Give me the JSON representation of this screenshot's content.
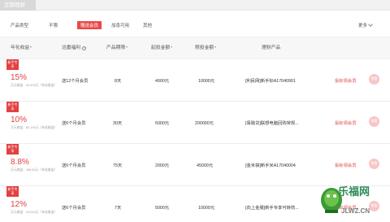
{
  "tabs": {
    "active_label": "定期理财"
  },
  "filter": {
    "label": "产品类型",
    "options": [
      {
        "label": "不限",
        "selected": false
      },
      {
        "label": "赠送会员",
        "selected": true
      },
      {
        "label": "加息可用",
        "selected": false
      },
      {
        "label": "其他",
        "selected": false
      }
    ],
    "more_label": "更多"
  },
  "table": {
    "headers": [
      "年化收益",
      "迅雷福利",
      "产品期限",
      "起投金额",
      "限投金额",
      "理财产品"
    ],
    "rows": [
      {
        "badge": "新手专享",
        "rate": "15%",
        "sub": "万元收益：32.876元（年化收益）",
        "welfare": "送12个月会员",
        "term": "8天",
        "min": "4000元",
        "max": "10000元",
        "product": "[利民网]新手标A17040901",
        "action": "投标领会员",
        "circle": "售罄"
      },
      {
        "badge": "新手专享",
        "rate": "10%",
        "sub": "万元收益：82.191元（年化收益）",
        "welfare": "送6个月会员",
        "term": "30天",
        "min": "5000元",
        "max": "200000元",
        "product": "[易融贷]联想电脑回购常规...",
        "action": "投标领会员",
        "circle": "售罄"
      },
      {
        "badge": "新手专享",
        "rate": "8.8%",
        "sub": "万元收益：168.82元（年化收益）",
        "welfare": "送6个月会员",
        "term": "75天",
        "min": "2000元",
        "max": "45000元",
        "product": "[金米袋]新手米A17040004",
        "action": "投标领会员",
        "circle": "售罄"
      },
      {
        "badge": "新手专享",
        "rate": "12%",
        "sub": "万元收益：23.013元（年化收益）",
        "welfare": "送6个月会员",
        "term": "7天",
        "min": "5000元",
        "max": "10000元",
        "product": "[向上金服]新手专享可转债...",
        "action": "投标领会员",
        "circle": "售罄"
      }
    ]
  },
  "watermark": {
    "text": "乐福网",
    "url": "JLWZ.CN"
  }
}
